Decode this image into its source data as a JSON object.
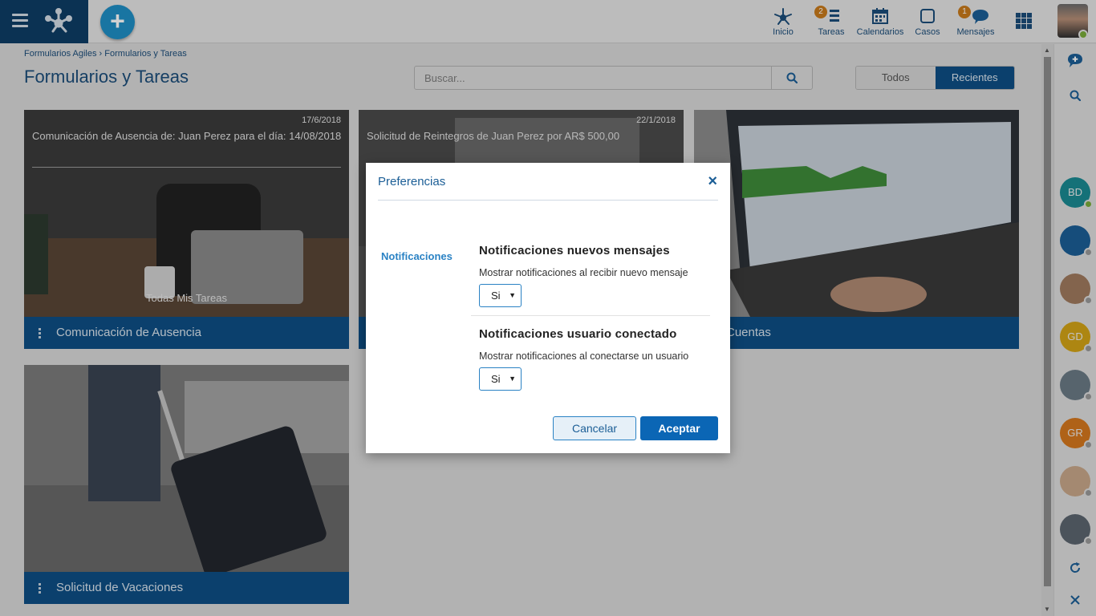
{
  "nav": {
    "items": [
      {
        "label": "Inicio",
        "icon": "network-icon"
      },
      {
        "label": "Tareas",
        "icon": "task-list-icon",
        "badge": "2"
      },
      {
        "label": "Calendarios",
        "icon": "calendar-icon"
      },
      {
        "label": "Casos",
        "icon": "square-icon"
      },
      {
        "label": "Mensajes",
        "icon": "chat-bubble-icon",
        "badge": "1"
      }
    ]
  },
  "breadcrumb": {
    "root": "Formularios Agiles",
    "separator": "›",
    "current": "Formularios y Tareas"
  },
  "page": {
    "title": "Formularios y Tareas"
  },
  "search": {
    "placeholder": "Buscar..."
  },
  "filters": {
    "all": "Todos",
    "recent": "Recientes",
    "selected": "Recientes"
  },
  "cards": [
    {
      "date": "17/6/2018",
      "headline": "Comunicación de Ausencia de: Juan Perez para el día: 14/08/2018",
      "caption": "Todas Mis Tareas",
      "footer": "Comunicación de Ausencia"
    },
    {
      "date": "22/1/2018",
      "headline": "Solicitud de Reintegros de Juan  Perez por  AR$  500,00",
      "footer": ""
    },
    {
      "footer": "Cuentas"
    },
    {
      "footer": "Solicitud de Vacaciones"
    }
  ],
  "rail": {
    "contacts": [
      {
        "initials": "BD",
        "color": "#1a8a93",
        "status": "online"
      },
      {
        "initials": "",
        "color": "#1b5e96",
        "status": "offline"
      },
      {
        "initials": "",
        "color": "#a07a5e",
        "status": "offline"
      },
      {
        "initials": "GD",
        "color": "#d4a416",
        "status": "offline"
      },
      {
        "initials": "",
        "color": "#6b7a86",
        "status": "offline"
      },
      {
        "initials": "GR",
        "color": "#d6781e",
        "status": "offline"
      },
      {
        "initials": "",
        "color": "#c9a88a",
        "status": "offline"
      },
      {
        "initials": "",
        "color": "#5c6670",
        "status": "offline"
      }
    ]
  },
  "modal": {
    "title": "Preferencias",
    "tab": "Notificaciones",
    "sections": [
      {
        "title": "Notificaciones nuevos mensajes",
        "description": "Mostrar notificaciones al recibir nuevo mensaje",
        "value": "Si"
      },
      {
        "title": "Notificaciones usuario conectado",
        "description": "Mostrar notificaciones al conectarse un usuario",
        "value": "Si"
      }
    ],
    "cancel": "Cancelar",
    "accept": "Aceptar"
  },
  "colors": {
    "primary": "#0e4f85",
    "accent": "#2a82c4",
    "badge": "#c97a1c",
    "online": "#7aac3a"
  }
}
